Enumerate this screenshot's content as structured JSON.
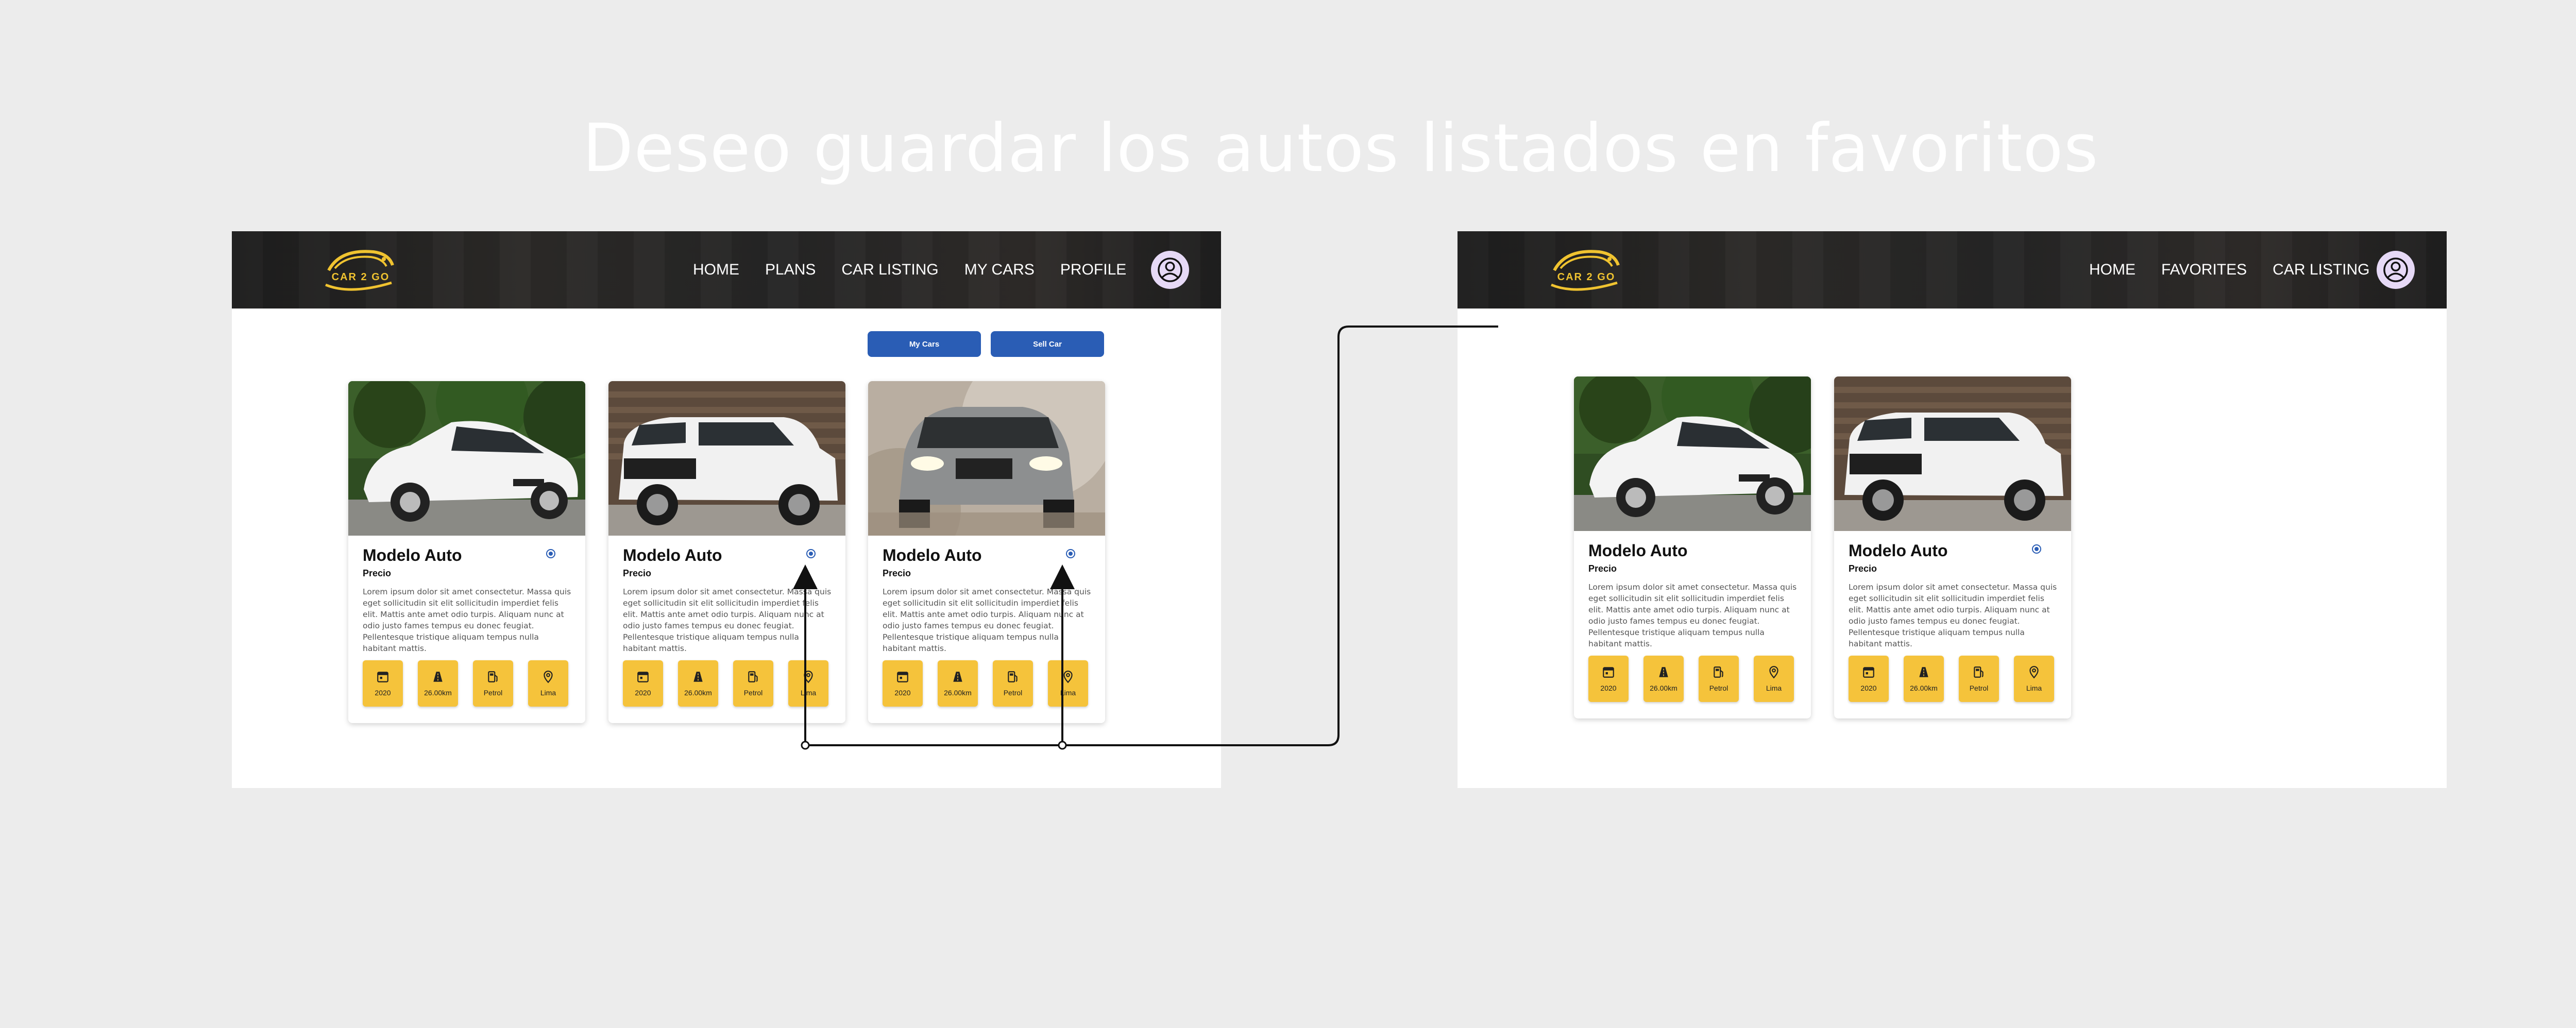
{
  "heading": "Deseo guardar los autos listados en favoritos",
  "colors": {
    "accent_blue": "#2a5db5",
    "chip_yellow": "#f5c33b",
    "logo_gold": "#f0c330",
    "navbar": "#262626",
    "avatar_bg": "#e6d9f6"
  },
  "logo": {
    "text": "CAR 2 GO"
  },
  "screen_before": {
    "nav": [
      "HOME",
      "PLANS",
      "CAR LISTING",
      "MY CARS",
      "PROFILE"
    ],
    "buttons": {
      "my_cars": "My Cars",
      "sell_car": "Sell Car"
    },
    "cards": [
      {
        "image": "white-bmw-sedan",
        "title": "Modelo Auto",
        "price": "Precio",
        "desc": "Lorem ipsum dolor sit amet consectetur. Massa quis eget sollicitudin sit elit sollicitudin imperdiet felis elit. Mattis ante amet odio turpis. Aliquam nunc at odio justo fames tempus eu donec feugiat. Pellentesque tristique aliquam tempus nulla habitant mattis.",
        "specs": [
          "2020",
          "26.00km",
          "Petrol",
          "Lima"
        ]
      },
      {
        "image": "white-jeep-suv",
        "title": "Modelo Auto",
        "price": "Precio",
        "desc": "Lorem ipsum dolor sit amet consectetur. Massa quis eget sollicitudin sit elit sollicitudin imperdiet felis elit. Mattis ante amet odio turpis. Aliquam nunc at odio justo fames tempus eu donec feugiat. Pellentesque tristique aliquam tempus nulla habitant mattis.",
        "specs": [
          "2020",
          "26.00km",
          "Petrol",
          "Lima"
        ]
      },
      {
        "image": "silver-bmw-suv",
        "title": "Modelo Auto",
        "price": "Precio",
        "desc": "Lorem ipsum dolor sit amet consectetur. Massa quis eget sollicitudin sit elit sollicitudin imperdiet felis elit. Mattis ante amet odio turpis. Aliquam nunc at odio justo fames tempus eu donec feugiat. Pellentesque tristique aliquam tempus nulla habitant mattis.",
        "specs": [
          "2020",
          "26.00km",
          "Petrol",
          "Lima"
        ]
      }
    ]
  },
  "screen_after": {
    "nav": [
      "HOME",
      "FAVORITES",
      "CAR LISTING"
    ],
    "cards": [
      {
        "image": "white-bmw-sedan",
        "title": "Modelo Auto",
        "price": "Precio",
        "desc": "Lorem ipsum dolor sit amet consectetur. Massa quis eget sollicitudin sit elit sollicitudin imperdiet felis elit. Mattis ante amet odio turpis. Aliquam nunc at odio justo fames tempus eu donec feugiat. Pellentesque tristique aliquam tempus nulla habitant mattis.",
        "specs": [
          "2020",
          "26.00km",
          "Petrol",
          "Lima"
        ]
      },
      {
        "image": "white-jeep-suv",
        "title": "Modelo Auto",
        "price": "Precio",
        "desc": "Lorem ipsum dolor sit amet consectetur. Massa quis eget sollicitudin sit elit sollicitudin imperdiet felis elit. Mattis ante amet odio turpis. Aliquam nunc at odio justo fames tempus eu donec feugiat. Pellentesque tristique aliquam tempus nulla habitant mattis.",
        "specs": [
          "2020",
          "26.00km",
          "Petrol",
          "Lima"
        ]
      }
    ]
  },
  "spec_icons": [
    "calendar-icon",
    "road-icon",
    "fuel-icon",
    "location-pin-icon"
  ]
}
